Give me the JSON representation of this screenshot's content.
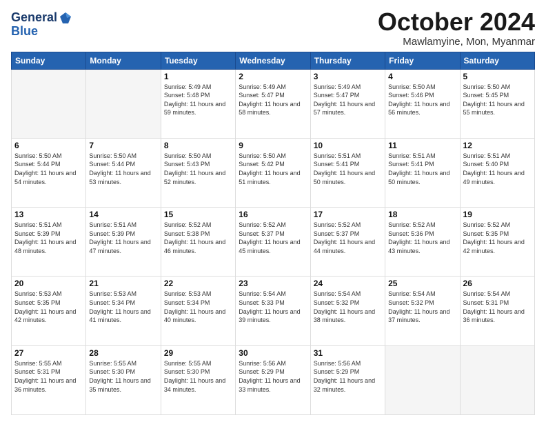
{
  "header": {
    "logo_line1": "General",
    "logo_line2": "Blue",
    "month_title": "October 2024",
    "location": "Mawlamyine, Mon, Myanmar"
  },
  "weekdays": [
    "Sunday",
    "Monday",
    "Tuesday",
    "Wednesday",
    "Thursday",
    "Friday",
    "Saturday"
  ],
  "weeks": [
    [
      {
        "day": "",
        "info": ""
      },
      {
        "day": "",
        "info": ""
      },
      {
        "day": "1",
        "info": "Sunrise: 5:49 AM\nSunset: 5:48 PM\nDaylight: 11 hours and 59 minutes."
      },
      {
        "day": "2",
        "info": "Sunrise: 5:49 AM\nSunset: 5:47 PM\nDaylight: 11 hours and 58 minutes."
      },
      {
        "day": "3",
        "info": "Sunrise: 5:49 AM\nSunset: 5:47 PM\nDaylight: 11 hours and 57 minutes."
      },
      {
        "day": "4",
        "info": "Sunrise: 5:50 AM\nSunset: 5:46 PM\nDaylight: 11 hours and 56 minutes."
      },
      {
        "day": "5",
        "info": "Sunrise: 5:50 AM\nSunset: 5:45 PM\nDaylight: 11 hours and 55 minutes."
      }
    ],
    [
      {
        "day": "6",
        "info": "Sunrise: 5:50 AM\nSunset: 5:44 PM\nDaylight: 11 hours and 54 minutes."
      },
      {
        "day": "7",
        "info": "Sunrise: 5:50 AM\nSunset: 5:44 PM\nDaylight: 11 hours and 53 minutes."
      },
      {
        "day": "8",
        "info": "Sunrise: 5:50 AM\nSunset: 5:43 PM\nDaylight: 11 hours and 52 minutes."
      },
      {
        "day": "9",
        "info": "Sunrise: 5:50 AM\nSunset: 5:42 PM\nDaylight: 11 hours and 51 minutes."
      },
      {
        "day": "10",
        "info": "Sunrise: 5:51 AM\nSunset: 5:41 PM\nDaylight: 11 hours and 50 minutes."
      },
      {
        "day": "11",
        "info": "Sunrise: 5:51 AM\nSunset: 5:41 PM\nDaylight: 11 hours and 50 minutes."
      },
      {
        "day": "12",
        "info": "Sunrise: 5:51 AM\nSunset: 5:40 PM\nDaylight: 11 hours and 49 minutes."
      }
    ],
    [
      {
        "day": "13",
        "info": "Sunrise: 5:51 AM\nSunset: 5:39 PM\nDaylight: 11 hours and 48 minutes."
      },
      {
        "day": "14",
        "info": "Sunrise: 5:51 AM\nSunset: 5:39 PM\nDaylight: 11 hours and 47 minutes."
      },
      {
        "day": "15",
        "info": "Sunrise: 5:52 AM\nSunset: 5:38 PM\nDaylight: 11 hours and 46 minutes."
      },
      {
        "day": "16",
        "info": "Sunrise: 5:52 AM\nSunset: 5:37 PM\nDaylight: 11 hours and 45 minutes."
      },
      {
        "day": "17",
        "info": "Sunrise: 5:52 AM\nSunset: 5:37 PM\nDaylight: 11 hours and 44 minutes."
      },
      {
        "day": "18",
        "info": "Sunrise: 5:52 AM\nSunset: 5:36 PM\nDaylight: 11 hours and 43 minutes."
      },
      {
        "day": "19",
        "info": "Sunrise: 5:52 AM\nSunset: 5:35 PM\nDaylight: 11 hours and 42 minutes."
      }
    ],
    [
      {
        "day": "20",
        "info": "Sunrise: 5:53 AM\nSunset: 5:35 PM\nDaylight: 11 hours and 42 minutes."
      },
      {
        "day": "21",
        "info": "Sunrise: 5:53 AM\nSunset: 5:34 PM\nDaylight: 11 hours and 41 minutes."
      },
      {
        "day": "22",
        "info": "Sunrise: 5:53 AM\nSunset: 5:34 PM\nDaylight: 11 hours and 40 minutes."
      },
      {
        "day": "23",
        "info": "Sunrise: 5:54 AM\nSunset: 5:33 PM\nDaylight: 11 hours and 39 minutes."
      },
      {
        "day": "24",
        "info": "Sunrise: 5:54 AM\nSunset: 5:32 PM\nDaylight: 11 hours and 38 minutes."
      },
      {
        "day": "25",
        "info": "Sunrise: 5:54 AM\nSunset: 5:32 PM\nDaylight: 11 hours and 37 minutes."
      },
      {
        "day": "26",
        "info": "Sunrise: 5:54 AM\nSunset: 5:31 PM\nDaylight: 11 hours and 36 minutes."
      }
    ],
    [
      {
        "day": "27",
        "info": "Sunrise: 5:55 AM\nSunset: 5:31 PM\nDaylight: 11 hours and 36 minutes."
      },
      {
        "day": "28",
        "info": "Sunrise: 5:55 AM\nSunset: 5:30 PM\nDaylight: 11 hours and 35 minutes."
      },
      {
        "day": "29",
        "info": "Sunrise: 5:55 AM\nSunset: 5:30 PM\nDaylight: 11 hours and 34 minutes."
      },
      {
        "day": "30",
        "info": "Sunrise: 5:56 AM\nSunset: 5:29 PM\nDaylight: 11 hours and 33 minutes."
      },
      {
        "day": "31",
        "info": "Sunrise: 5:56 AM\nSunset: 5:29 PM\nDaylight: 11 hours and 32 minutes."
      },
      {
        "day": "",
        "info": ""
      },
      {
        "day": "",
        "info": ""
      }
    ]
  ]
}
